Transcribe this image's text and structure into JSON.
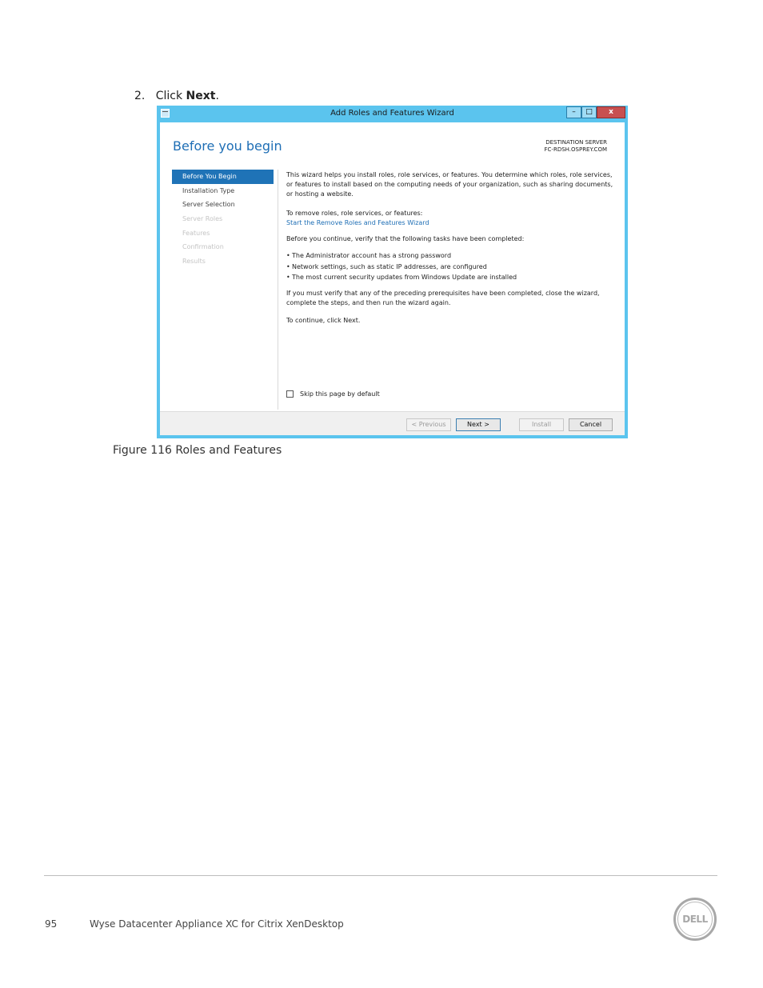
{
  "step": {
    "number": "2.",
    "prefix": "Click ",
    "bold": "Next",
    "suffix": "."
  },
  "window": {
    "title": "Add Roles and Features Wizard",
    "min_glyph": "–",
    "max_glyph": "□",
    "close_glyph": "x",
    "icon": "wizard-app-icon",
    "page_heading": "Before you begin",
    "destination_label": "DESTINATION SERVER",
    "destination_value": "FC-RDSH.OSPREY.COM",
    "nav": [
      {
        "label": "Before You Begin",
        "state": "active"
      },
      {
        "label": "Installation Type",
        "state": "enabled"
      },
      {
        "label": "Server Selection",
        "state": "enabled"
      },
      {
        "label": "Server Roles",
        "state": "disabled"
      },
      {
        "label": "Features",
        "state": "disabled"
      },
      {
        "label": "Confirmation",
        "state": "disabled"
      },
      {
        "label": "Results",
        "state": "disabled"
      }
    ],
    "intro": "This wizard helps you install roles, role services, or features. You determine which roles, role services, or features to install based on the computing needs of your organization, such as sharing documents, or hosting a website.",
    "remove_label": "To remove roles, role services, or features:",
    "remove_link": "Start the Remove Roles and Features Wizard",
    "verify_label": "Before you continue, verify that the following tasks have been completed:",
    "bullets": [
      "The Administrator account has a strong password",
      "Network settings, such as static IP addresses, are configured",
      "The most current security updates from Windows Update are installed"
    ],
    "prereq_note": "If you must verify that any of the preceding prerequisites have been completed, close the wizard, complete the steps, and then run the wizard again.",
    "continue_note": "To continue, click Next.",
    "skip_label": "Skip this page by default",
    "buttons": {
      "previous": "< Previous",
      "next": "Next >",
      "install": "Install",
      "cancel": "Cancel"
    }
  },
  "caption": "Figure 116 Roles and Features",
  "footer": {
    "page_number": "95",
    "doc_title": "Wyse Datacenter Appliance XC for Citrix XenDesktop",
    "logo_text": "DELL"
  }
}
